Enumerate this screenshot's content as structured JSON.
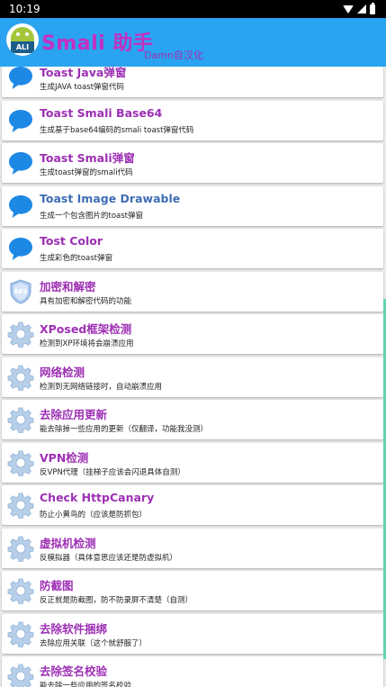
{
  "status_bar": {
    "time": "10:19"
  },
  "app_bar": {
    "title": "Smali 助手",
    "subtitle": "Damn自汉化",
    "logo_text": "ALI"
  },
  "colors": {
    "app_bar": "#2aa3f0",
    "title_blue": "#3f6db5",
    "title_purple": "#9d2fb4",
    "chat_icon": "#1e88e5",
    "gear_icon": "#b7cfe8",
    "scrollbar": "#61d5a8"
  },
  "items": [
    {
      "name": "toast-java",
      "icon": "chat-bubble-icon",
      "title": "Toast Java弹窗",
      "desc": "生成JAVA toast弹窗代码",
      "color": "purple"
    },
    {
      "name": "toast-smali-base64",
      "icon": "chat-bubble-icon",
      "title": "Toast Smali Base64",
      "desc": "生成基于base64编码的smali toast弹窗代码",
      "color": "purple"
    },
    {
      "name": "toast-smali",
      "icon": "chat-bubble-icon",
      "title": "Toast Smali弹窗",
      "desc": "生成toast弹窗的smali代码",
      "color": "purple"
    },
    {
      "name": "toast-image-drawable",
      "icon": "chat-bubble-icon",
      "title": "Toast Image Drawable",
      "desc": "生成一个包含图片的toast弹窗",
      "color": "blue"
    },
    {
      "name": "tost-color",
      "icon": "chat-bubble-icon",
      "title": "Tost Color",
      "desc": "生成彩色的toast弹窗",
      "color": "purple"
    },
    {
      "name": "encrypt-decrypt",
      "icon": "aes-shield-icon",
      "title": "加密和解密",
      "desc": "具有加密和解密代码的功能",
      "color": "purple"
    },
    {
      "name": "xposed-detect",
      "icon": "gear-icon",
      "title": "XPosed框架检测",
      "desc": "检测到XP环境将会崩溃应用",
      "color": "purple"
    },
    {
      "name": "network-detect",
      "icon": "gear-icon",
      "title": "网络检测",
      "desc": "检测到无网络链接时，自动崩溃应用",
      "color": "purple"
    },
    {
      "name": "remove-update",
      "icon": "gear-icon",
      "title": "去除应用更新",
      "desc": "能去除掉一些应用的更新（仅翻译，功能我没测）",
      "color": "purple"
    },
    {
      "name": "vpn-detect",
      "icon": "gear-icon",
      "title": "VPN检测",
      "desc": "反VPN代理（挂梯子应该会闪退具体自测）",
      "color": "purple"
    },
    {
      "name": "check-httpcanary",
      "icon": "gear-icon",
      "title": "Check HttpCanary",
      "desc": "防止小黄鸟的（应该是防抓包）",
      "color": "purple"
    },
    {
      "name": "emulator-detect",
      "icon": "gear-icon",
      "title": "虚拟机检测",
      "desc": "反模拟器（具体意思应该还是防虚拟机）",
      "color": "purple"
    },
    {
      "name": "anti-screenshot",
      "icon": "gear-icon",
      "title": "防截图",
      "desc": "反正就是防截图，防不防录屏不清楚（自测）",
      "color": "purple"
    },
    {
      "name": "remove-bundle",
      "icon": "gear-icon",
      "title": "去除软件捆绑",
      "desc": "去除应用关联（这个就舒服了）",
      "color": "purple"
    },
    {
      "name": "remove-signature",
      "icon": "gear-icon",
      "title": "去除签名校验",
      "desc": "能去除一些应用的签名校验",
      "color": "purple"
    }
  ]
}
